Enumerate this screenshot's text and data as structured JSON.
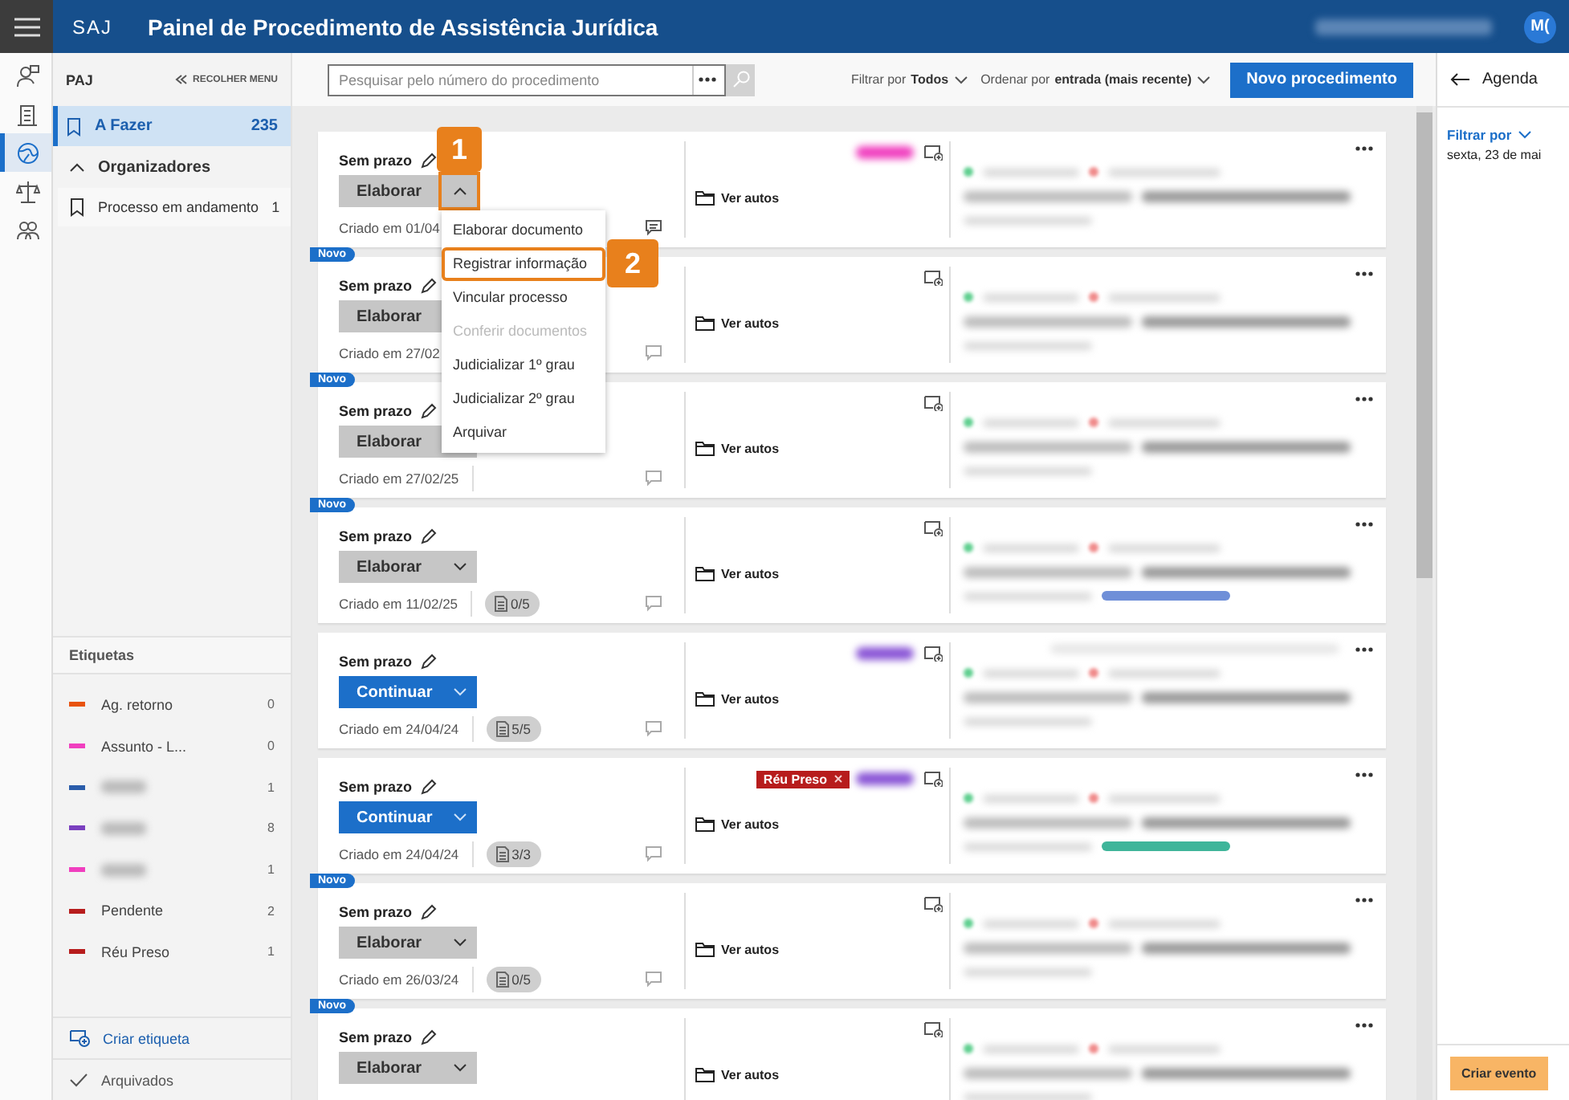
{
  "header": {
    "logo": "SAJ",
    "title": "Painel de Procedimento de Assistência Jurídica",
    "user_initials": "M("
  },
  "rail": [
    {
      "kind": "people",
      "selected": false
    },
    {
      "kind": "building",
      "selected": false
    },
    {
      "kind": "globe",
      "selected": true
    },
    {
      "kind": "scales",
      "selected": false
    },
    {
      "kind": "group",
      "selected": false
    }
  ],
  "sidebar": {
    "section": "PAJ",
    "collapse": "RECOLHER MENU",
    "items": [
      {
        "label": "A Fazer",
        "count": "235",
        "selected": true
      }
    ],
    "organizers": {
      "label": "Organizadores",
      "expanded": true,
      "items": [
        {
          "label": "Processo em andamento",
          "count": "1",
          "selected": false
        }
      ]
    },
    "tags_title": "Etiquetas",
    "tags": [
      {
        "label": "Ag. retorno",
        "count": "0",
        "color": "#e8530e",
        "redacted": false
      },
      {
        "label": "Assunto - L...",
        "count": "0",
        "color": "#f03fbf",
        "redacted": false
      },
      {
        "count": "1",
        "color": "#2a5caa",
        "redacted": true
      },
      {
        "count": "8",
        "color": "#7a3fbf",
        "redacted": true
      },
      {
        "count": "1",
        "color": "#f03fbf",
        "redacted": true
      },
      {
        "label": "Pendente",
        "count": "2",
        "color": "#b71c1c",
        "redacted": false
      },
      {
        "label": "Réu Preso",
        "count": "1",
        "color": "#b71c1c",
        "redacted": false
      }
    ],
    "create_tag": "Criar etiqueta",
    "archived": "Arquivados"
  },
  "toolbar": {
    "search_placeholder": "Pesquisar pelo número do procedimento",
    "filter": {
      "prefix": "Filtrar por",
      "value": "Todos"
    },
    "sort": {
      "prefix": "Ordenar por",
      "value": "entrada (mais recente)"
    },
    "new_button": "Novo procedimento"
  },
  "cards": [
    {
      "new": false,
      "deadline": "Sem prazo",
      "action": {
        "label": "Elaborar",
        "kind": "secondary",
        "menu_open": true
      },
      "created": "Criado em 01/04",
      "has_comments": true,
      "tags": [
        {
          "redacted": true,
          "color": "#f03fbf"
        }
      ],
      "link": "Ver autos"
    },
    {
      "new": true,
      "badge": "Novo",
      "deadline": "Sem prazo",
      "action": {
        "label": "Elaborar",
        "kind": "secondary",
        "caret_hidden": true
      },
      "created": "Criado em 27/02",
      "has_comments": false,
      "link": "Ver autos"
    },
    {
      "new": true,
      "badge": "Novo",
      "deadline": "Sem prazo",
      "action": {
        "label": "Elaborar",
        "kind": "secondary",
        "caret_hidden": true
      },
      "created": "Criado em 27/02/25",
      "has_comments": false,
      "link": "Ver autos"
    },
    {
      "new": true,
      "badge": "Novo",
      "deadline": "Sem prazo",
      "action": {
        "label": "Elaborar",
        "kind": "secondary",
        "menu_open": false
      },
      "created": "Criado em 11/02/25",
      "docs": "0/5",
      "has_comments": false,
      "link": "Ver autos",
      "chip": {
        "color": "#6f8fd8"
      }
    },
    {
      "new": false,
      "deadline": "Sem prazo",
      "action": {
        "label": "Continuar",
        "kind": "primary",
        "menu_open": false
      },
      "created": "Criado em 24/04/24",
      "docs": "5/5",
      "has_comments": false,
      "tags": [
        {
          "redacted": true,
          "color": "#8a55d6"
        }
      ],
      "link": "Ver autos",
      "note": true
    },
    {
      "new": false,
      "deadline": "Sem prazo",
      "action": {
        "label": "Continuar",
        "kind": "primary",
        "menu_open": false
      },
      "created": "Criado em 24/04/24",
      "docs": "3/3",
      "has_comments": false,
      "tags": [
        {
          "label": "Réu Preso",
          "color": "#b71c1c",
          "redacted": false
        },
        {
          "redacted": true,
          "color": "#8a55d6"
        }
      ],
      "link": "Ver autos",
      "chip": {
        "color": "#3fb59a"
      }
    },
    {
      "new": true,
      "badge": "Novo",
      "deadline": "Sem prazo",
      "action": {
        "label": "Elaborar",
        "kind": "secondary",
        "menu_open": false
      },
      "created": "Criado em 26/03/24",
      "docs": "0/5",
      "has_comments": false,
      "link": "Ver autos"
    },
    {
      "new": true,
      "badge": "Novo",
      "deadline": "Sem prazo",
      "action": {
        "label": "Elaborar",
        "kind": "secondary",
        "menu_open": false
      },
      "link": "Ver autos"
    }
  ],
  "action_menu": {
    "items": [
      {
        "label": "Elaborar documento",
        "disabled": false,
        "highlighted": false
      },
      {
        "label": "Registrar informação",
        "disabled": false,
        "highlighted": true
      },
      {
        "label": "Vincular processo",
        "disabled": false,
        "highlighted": false
      },
      {
        "label": "Conferir documentos",
        "disabled": true,
        "highlighted": false
      },
      {
        "label": "Judicializar 1º grau",
        "disabled": false,
        "highlighted": false
      },
      {
        "label": "Judicializar 2º grau",
        "disabled": false,
        "highlighted": false
      },
      {
        "label": "Arquivar",
        "disabled": false,
        "highlighted": false
      }
    ]
  },
  "callouts": [
    {
      "label": "1"
    },
    {
      "label": "2"
    }
  ],
  "agenda": {
    "title": "Agenda",
    "filter": "Filtrar por",
    "date": "sexta, 23 de mai",
    "create_button": "Criar evento"
  }
}
